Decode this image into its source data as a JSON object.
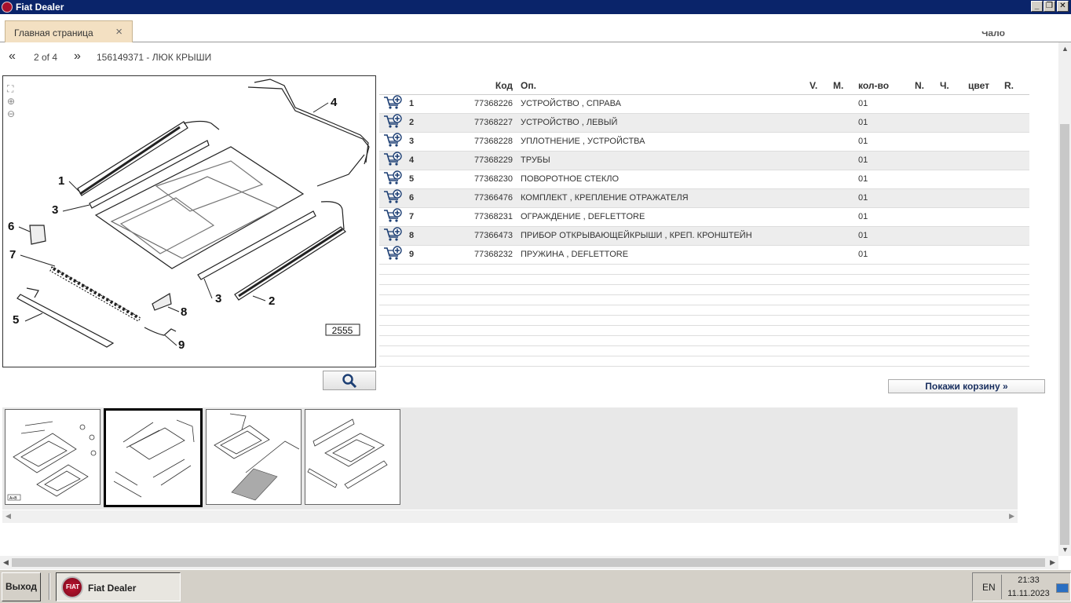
{
  "window": {
    "title": "Fiat Dealer"
  },
  "tabs": [
    {
      "label": "Главная страница",
      "close": "×"
    }
  ],
  "clipped_label": "Чало",
  "nav": {
    "first": "«",
    "page_info": "2 of 4",
    "next": "»",
    "group_title": "156149371 - ЛЮК КРЫШИ"
  },
  "drawing": {
    "code": "2555",
    "callouts": [
      "1",
      "2",
      "3",
      "3",
      "4",
      "5",
      "6",
      "7",
      "8",
      "9"
    ]
  },
  "table": {
    "headers": {
      "code": "Код",
      "desc": "Оп.",
      "v": "V.",
      "m": "M.",
      "qty": "кол-во",
      "n": "N.",
      "ch": "Ч.",
      "color": "цвет",
      "r": "R."
    },
    "rows": [
      {
        "num": "1",
        "code": "77368226",
        "desc": "УСТРОЙСТВО , СПРАВА",
        "qty": "01"
      },
      {
        "num": "2",
        "code": "77368227",
        "desc": "УСТРОЙСТВО , ЛЕВЫЙ",
        "qty": "01"
      },
      {
        "num": "3",
        "code": "77368228",
        "desc": "УПЛОТНЕНИЕ , УСТРОЙСТВА",
        "qty": "01"
      },
      {
        "num": "4",
        "code": "77368229",
        "desc": "ТРУБЫ",
        "qty": "01"
      },
      {
        "num": "5",
        "code": "77368230",
        "desc": "ПОВОРОТНОЕ СТЕКЛО",
        "qty": "01"
      },
      {
        "num": "6",
        "code": "77366476",
        "desc": "КОМПЛЕКТ , КРЕПЛЕНИЕ ОТРАЖАТЕЛЯ",
        "qty": "01"
      },
      {
        "num": "7",
        "code": "77368231",
        "desc": "ОГРАЖДЕНИЕ , DEFLETTORE",
        "qty": "01"
      },
      {
        "num": "8",
        "code": "77366473",
        "desc": "ПРИБОР ОТКРЫВАЮЩЕЙКРЫШИ , КРЕП. КРОНШТЕЙН",
        "qty": "01"
      },
      {
        "num": "9",
        "code": "77368232",
        "desc": "ПРУЖИНА , DEFLETTORE",
        "qty": "01"
      }
    ]
  },
  "basket_button": "Покажи корзину »",
  "thumbnails": [
    {
      "label": "A+B"
    },
    {
      "label": ""
    },
    {
      "label": ""
    },
    {
      "label": ""
    }
  ],
  "taskbar": {
    "exit": "Выход",
    "app": "Fiat Dealer",
    "lang": "EN",
    "time": "21:33",
    "date": "11.11.2023",
    "app_icon_text": "FIAT"
  },
  "colors": {
    "titlebar": "#0a246a",
    "tab": "#f3e0c2",
    "row_alt": "#ededed",
    "taskbar": "#d4d0c8"
  }
}
